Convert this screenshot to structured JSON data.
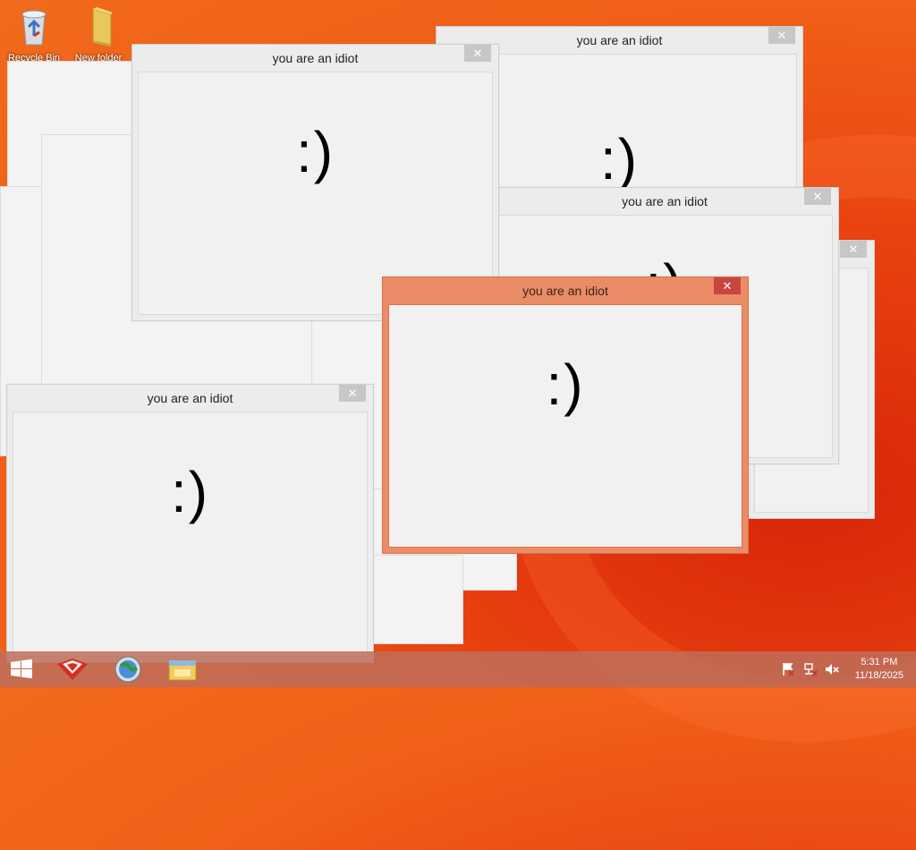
{
  "desktop": {
    "icons": [
      {
        "label": "Recycle Bin",
        "icon": "recycle-bin-icon"
      },
      {
        "label": "New folder",
        "icon": "folder-icon"
      }
    ]
  },
  "windows": [
    {
      "title": "you are an idiot",
      "face": ":)",
      "close": "✕",
      "state": "inactive"
    },
    {
      "title": "you are an idiot",
      "face": ":)",
      "close": "✕",
      "state": "inactive"
    },
    {
      "title": "you are an idiot",
      "face": ":)",
      "close": "✕",
      "state": "inactive"
    },
    {
      "title": "you are an idiot",
      "face": ":)",
      "close": "✕",
      "state": "inactive"
    },
    {
      "title": "you are an idiot",
      "face": ":)",
      "close": "✕",
      "state": "active"
    },
    {
      "title": "",
      "face": "",
      "close": "✕",
      "state": "inactive"
    }
  ],
  "taskbar": {
    "pinned": [
      {
        "icon": "start-windows-icon"
      },
      {
        "icon": "red-app-icon"
      },
      {
        "icon": "globe-browser-icon"
      },
      {
        "icon": "file-explorer-icon"
      }
    ],
    "tray": [
      {
        "icon": "action-center-flag-icon"
      },
      {
        "icon": "network-icon"
      },
      {
        "icon": "volume-muted-icon"
      }
    ],
    "clock": {
      "time": "5:31 PM",
      "date": "11/18/2025"
    }
  },
  "colors": {
    "active_frame": "#ea8c66",
    "active_close": "#c7463f",
    "inactive_frame": "#ececec"
  }
}
